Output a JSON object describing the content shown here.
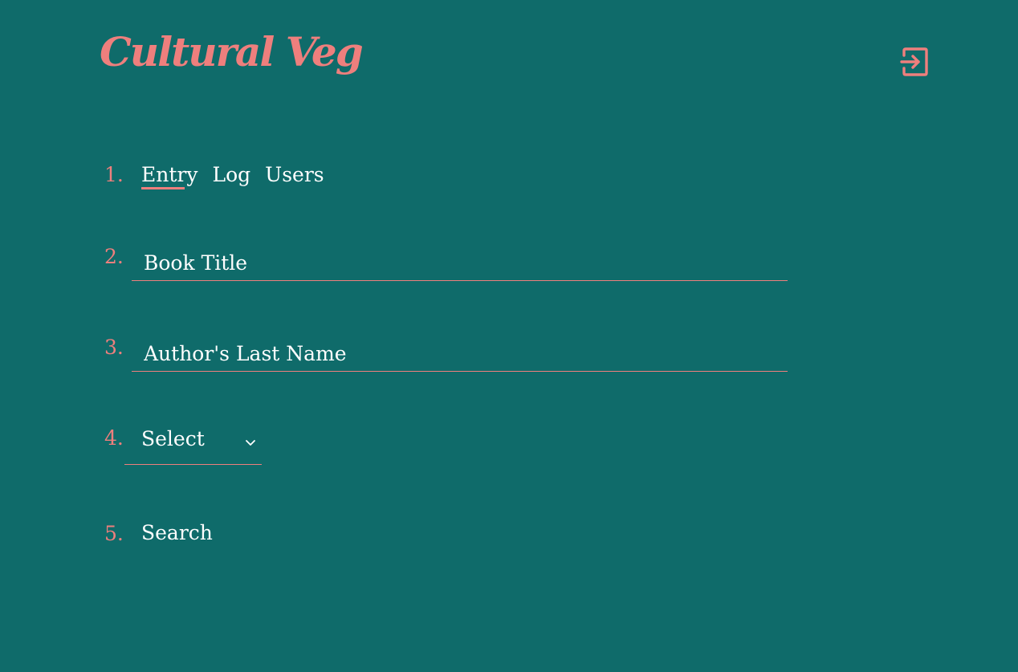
{
  "app": {
    "logo_text": "Cultural Veg",
    "accent_color": "#ee7f7d",
    "background_color": "#0f6b6a",
    "login_icon": "login-icon"
  },
  "steps": {
    "one": "1.",
    "two": "2.",
    "three": "3.",
    "four": "4.",
    "five": "5."
  },
  "tabs": [
    {
      "label": "Entry",
      "active": true
    },
    {
      "label": "Log",
      "active": false
    },
    {
      "label": "Users",
      "active": false
    }
  ],
  "form": {
    "book_title": {
      "placeholder": "Book Title",
      "value": ""
    },
    "author_last_name": {
      "placeholder": "Author's Last Name",
      "value": ""
    },
    "select": {
      "value": "Select",
      "icon": "chevron-down-icon"
    },
    "search_label": "Search"
  }
}
